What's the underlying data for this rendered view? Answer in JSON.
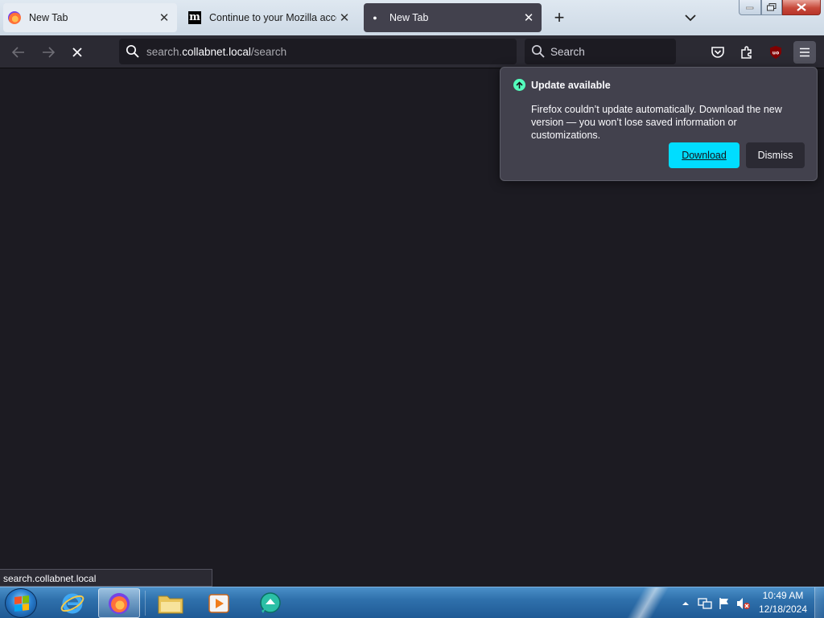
{
  "tabs": [
    {
      "title": "New Tab",
      "icon": "firefox-icon",
      "active": false
    },
    {
      "title": "Continue to your Mozilla account",
      "icon": "mozilla-m-icon",
      "active": false
    },
    {
      "title": "New Tab",
      "icon": "loading-dot",
      "active": true
    }
  ],
  "urlbar": {
    "pre": "search.",
    "host": "collabnet.local",
    "path": "/search"
  },
  "searchbar": {
    "placeholder": "Search"
  },
  "doorhanger": {
    "title": "Update available",
    "body": "Firefox couldn’t update automatically. Download the new version — you won’t lose saved information or customizations.",
    "download_label": "Download",
    "dismiss_label": "Dismiss",
    "accent": "#00ddff"
  },
  "status": {
    "text": "search.collabnet.local"
  },
  "taskbar": {
    "clock_time": "10:49 AM",
    "clock_date": "12/18/2024"
  },
  "colors": {
    "toolbar": "#2b2a33",
    "content": "#1c1b22",
    "popup": "#42414d"
  }
}
